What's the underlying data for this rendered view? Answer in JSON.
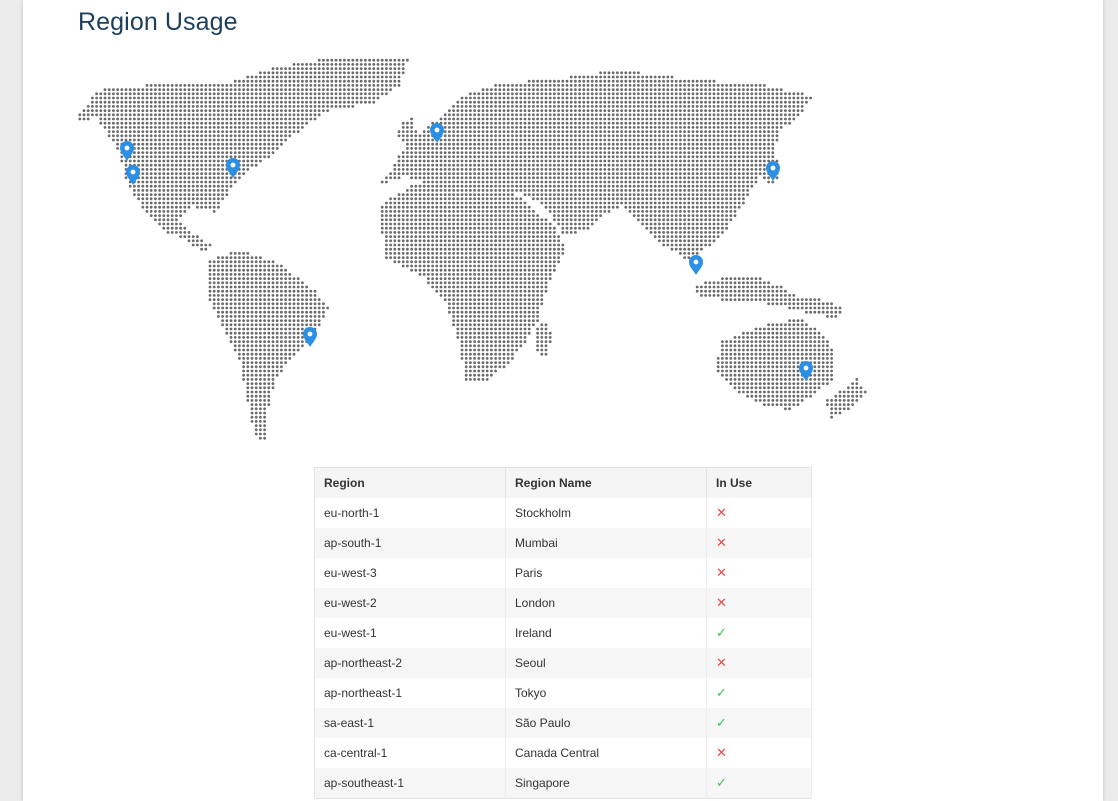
{
  "page": {
    "title": "Region Usage"
  },
  "map": {
    "dot_color": "#6a6a6a",
    "pin_color": "#2b8fe6",
    "pin_icon": "map-pin-icon"
  },
  "table": {
    "headers": [
      "Region",
      "Region Name",
      "In Use"
    ],
    "rows": [
      {
        "code": "eu-north-1",
        "name": "Stockholm",
        "in_use": false
      },
      {
        "code": "ap-south-1",
        "name": "Mumbai",
        "in_use": false
      },
      {
        "code": "eu-west-3",
        "name": "Paris",
        "in_use": false
      },
      {
        "code": "eu-west-2",
        "name": "London",
        "in_use": false
      },
      {
        "code": "eu-west-1",
        "name": "Ireland",
        "in_use": true
      },
      {
        "code": "ap-northeast-2",
        "name": "Seoul",
        "in_use": false
      },
      {
        "code": "ap-northeast-1",
        "name": "Tokyo",
        "in_use": true
      },
      {
        "code": "sa-east-1",
        "name": "São Paulo",
        "in_use": true
      },
      {
        "code": "ca-central-1",
        "name": "Canada Central",
        "in_use": false
      },
      {
        "code": "ap-southeast-1",
        "name": "Singapore",
        "in_use": true
      }
    ],
    "status_colors": {
      "yes": "#3cbf5a",
      "no": "#e64b4b"
    },
    "status_icons": {
      "yes": "check-icon",
      "no": "cross-icon"
    }
  }
}
